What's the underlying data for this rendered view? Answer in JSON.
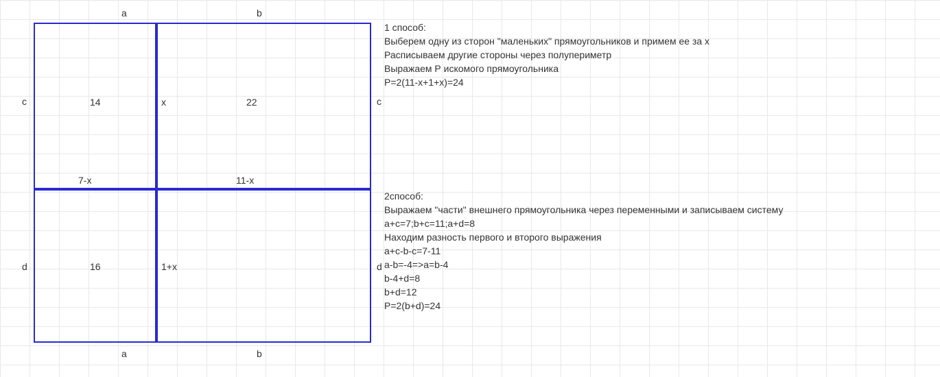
{
  "diagram": {
    "labels": {
      "a_top": "a",
      "b_top": "b",
      "a_bot": "a",
      "b_bot": "b",
      "c_left": "c",
      "c_right": "c",
      "d_left": "d",
      "d_right": "d",
      "val_14": "14",
      "val_22": "22",
      "val_16": "16",
      "x": "x",
      "seven_minus_x": "7-x",
      "eleven_minus_x": "11-x",
      "one_plus_x": "1+x"
    }
  },
  "method1": {
    "title": "1 способ:",
    "line1": "Выберем одну из сторон \"маленьких\" прямоугольников и примем ее за х",
    "line2": "Расписываем другие стороны через полупериметр",
    "line3": "Выражаем Р искомого прямоугольника",
    "line4": "Р=2(11-х+1+х)=24"
  },
  "method2": {
    "title": "2способ:",
    "line1": "Выражаем \"части\" внешнего прямоугольника через переменными и записываем систему",
    "line2": "a+c=7;b+c=11;a+d=8",
    "line3": "Находим разность первого и второго выражения",
    "line4": "a+c-b-c=7-11",
    "line5": "a-b=-4=>a=b-4",
    "line6": "b-4+d=8",
    "line7": "b+d=12",
    "line8": "P=2(b+d)=24"
  }
}
